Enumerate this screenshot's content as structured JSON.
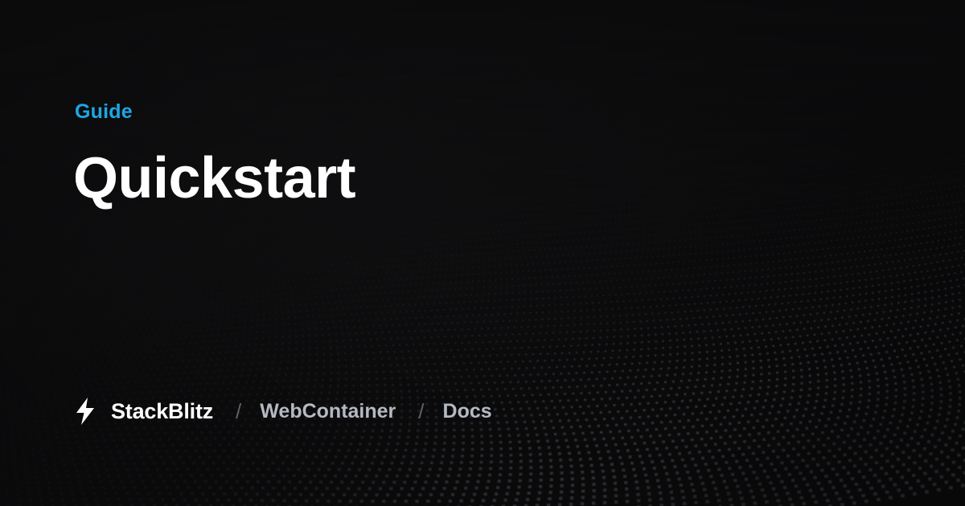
{
  "header": {
    "eyebrow": "Guide",
    "title": "Quickstart"
  },
  "footer": {
    "logo_icon": "lightning-bolt-icon",
    "brand": "StackBlitz",
    "separator": "/",
    "breadcrumbs": [
      "WebContainer",
      "Docs"
    ]
  },
  "colors": {
    "accent": "#1ea7e4",
    "background": "#0b0b0c",
    "title": "#ffffff",
    "crumb": "#b4b9c2",
    "separator": "#5d6169",
    "dots": "#9aa3b2"
  }
}
